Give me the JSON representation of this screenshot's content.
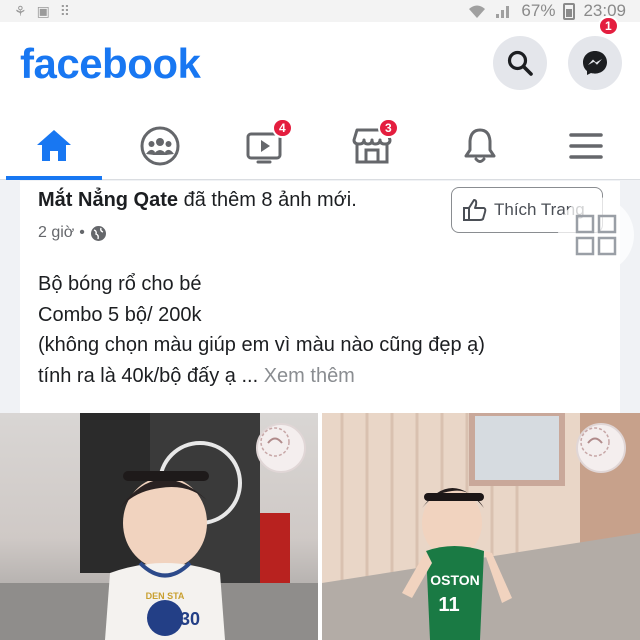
{
  "status_bar": {
    "battery": "67%",
    "time": "23:09",
    "icons": [
      "notification-icon",
      "signal-icon",
      "wifi-icon",
      "battery-icon"
    ]
  },
  "header": {
    "logo": "facebook",
    "search_icon": "search-icon",
    "messenger_icon": "messenger-icon",
    "messenger_badge": "1"
  },
  "nav": {
    "tabs": [
      {
        "name": "home",
        "icon": "home-icon",
        "active": true
      },
      {
        "name": "groups",
        "icon": "groups-icon"
      },
      {
        "name": "watch",
        "icon": "watch-icon",
        "badge": "4"
      },
      {
        "name": "marketplace",
        "icon": "marketplace-icon",
        "badge": "3"
      },
      {
        "name": "notifications",
        "icon": "bell-icon"
      },
      {
        "name": "menu",
        "icon": "menu-icon"
      }
    ]
  },
  "post": {
    "author": "Mắt Nẳng Qate",
    "action": "đã thêm 8 ảnh mới.",
    "time": "2 giờ",
    "like_page_label": "Thích Trang",
    "lines": [
      "Bộ bóng rổ cho bé",
      "Combo 5 bộ/ 200k",
      "(không chọn màu giúp em vì màu nào cũng đẹp ạ)",
      "tính ra là 40k/bộ đấy ạ ..."
    ],
    "see_more": "Xem thêm",
    "photos": [
      {
        "jersey_text": "DEN STA",
        "jersey_number": "30"
      },
      {
        "jersey_text": "OSTON",
        "jersey_number": "11"
      }
    ]
  },
  "colors": {
    "brand": "#1877f2",
    "badge": "#e41e3f",
    "text_secondary": "#65676b"
  }
}
